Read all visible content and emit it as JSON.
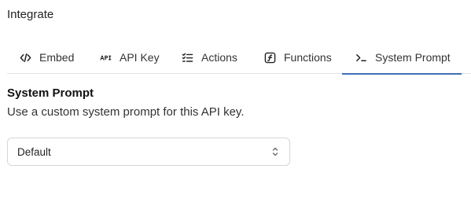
{
  "page": {
    "title": "Integrate"
  },
  "tabs": [
    {
      "label": "Embed",
      "icon": "code-icon",
      "active": false
    },
    {
      "label": "API Key",
      "icon": "api-icon",
      "active": false
    },
    {
      "label": "Actions",
      "icon": "checklist-icon",
      "active": false
    },
    {
      "label": "Functions",
      "icon": "function-icon",
      "active": false
    },
    {
      "label": "System Prompt",
      "icon": "terminal-prompt-icon",
      "active": true
    }
  ],
  "system_prompt": {
    "title": "System Prompt",
    "description": "Use a custom system prompt for this API key.",
    "select": {
      "value": "Default"
    }
  },
  "colors": {
    "accent": "#3d6fb6",
    "border": "#d6d6d6",
    "divider": "#e3e3e3"
  }
}
